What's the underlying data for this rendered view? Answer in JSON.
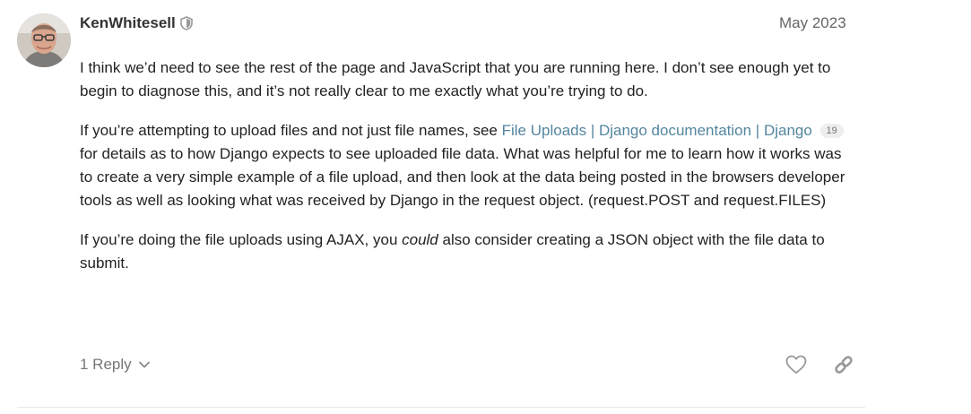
{
  "post": {
    "username": "KenWhitesell",
    "date": "May 2023",
    "paragraphs": {
      "p1": "I think we’d need to see the rest of the page and JavaScript that you are running here. I don’t see enough yet to begin to diagnose this, and it’s not really clear to me exactly what you’re trying to do.",
      "p2_before": "If you’re attempting to upload files and not just file names, see ",
      "p2_link": "File Uploads | Django documentation | Django",
      "p2_link_clicks": "19",
      "p2_after": "for details as to how Django expects to see uploaded file data. What was helpful for me to learn how it works was to create a very simple example of a file upload, and then look at the data being posted in the browsers developer tools as well as looking what was received by Django in the request object. (request.POST and request.FILES)",
      "p3_before": "If you’re doing the file uploads using AJAX, you ",
      "p3_emphasis": "could",
      "p3_after": " also consider creating a JSON object with the file data to submit."
    },
    "replies_label": "1 Reply",
    "icons": {
      "moderator": "shield-icon",
      "expand": "chevron-down-icon",
      "like": "heart-icon",
      "share": "link-icon"
    }
  }
}
